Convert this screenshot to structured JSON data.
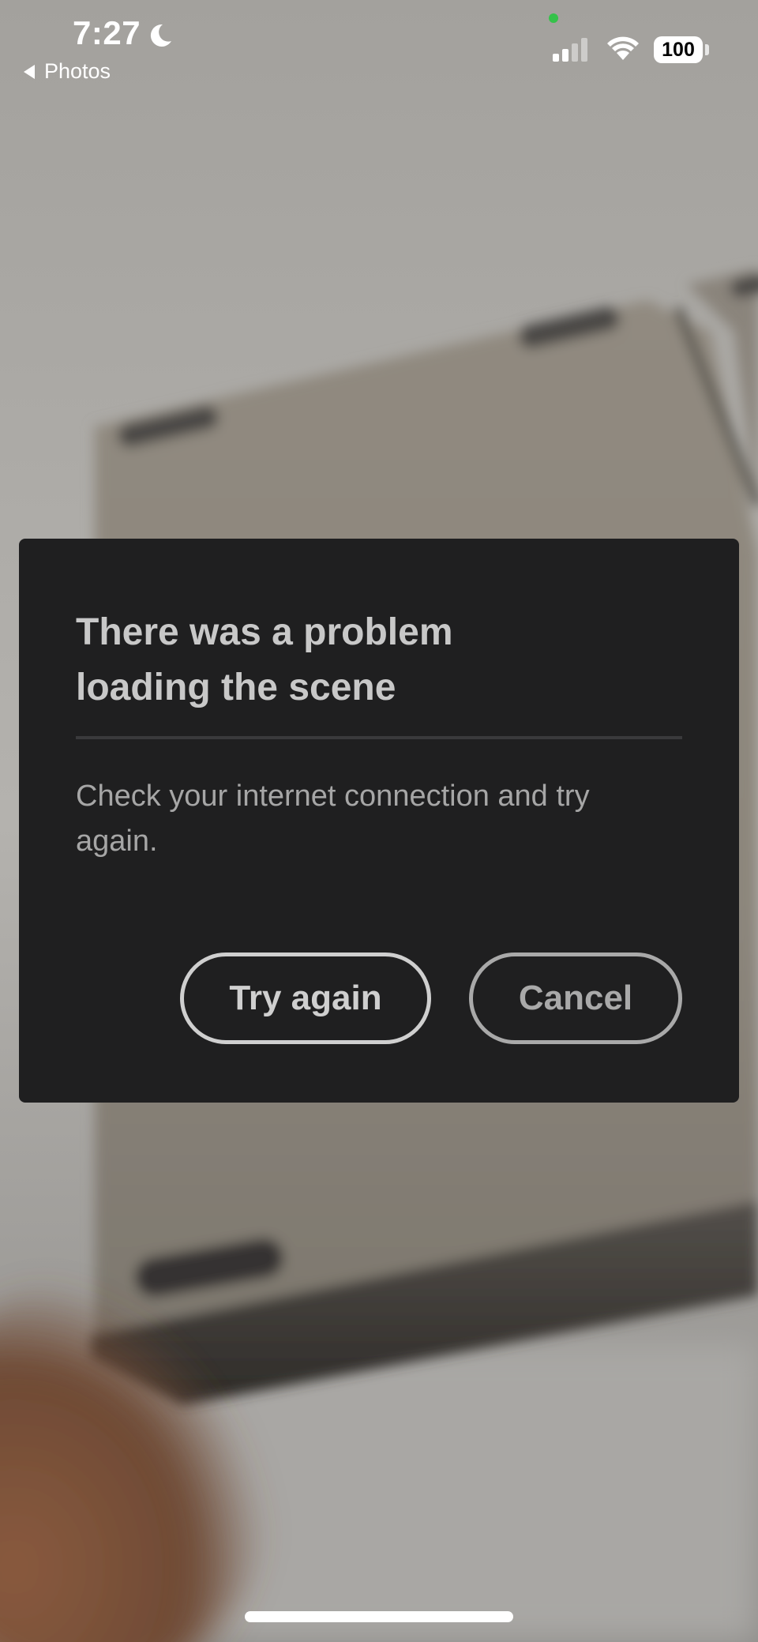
{
  "status_bar": {
    "time": "7:27",
    "back_label": "Photos",
    "battery": "100",
    "icons": [
      "moon-icon",
      "cellular-signal-icon",
      "wifi-icon",
      "battery-icon"
    ]
  },
  "dialog": {
    "title": "There was a problem loading the scene",
    "message": "Check your internet connection and try again.",
    "try_again_label": "Try again",
    "cancel_label": "Cancel"
  },
  "colors": {
    "dialog_bg": "#1f1f20",
    "title_text": "#c8c8c8",
    "message_text": "#a6a6a6",
    "camera_dot": "#35c24a"
  }
}
